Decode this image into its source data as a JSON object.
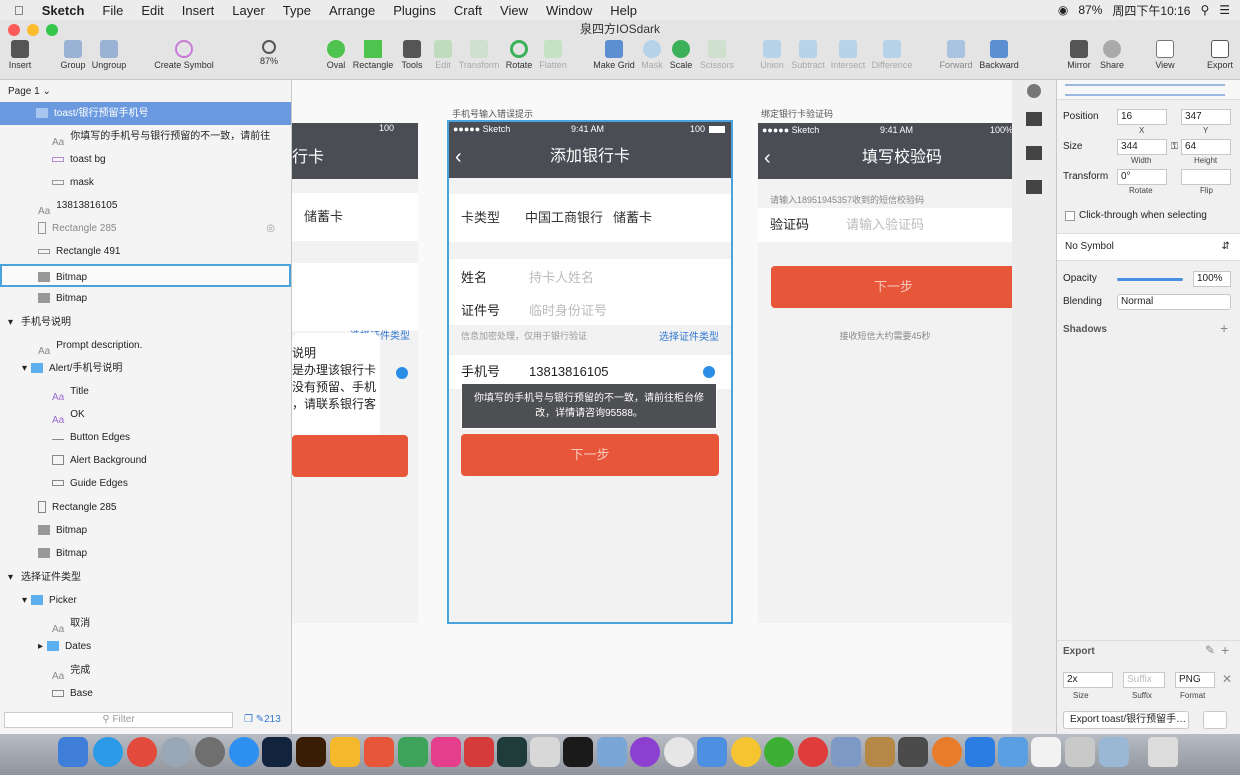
{
  "menubar": {
    "app": "Sketch",
    "items": [
      "File",
      "Edit",
      "Insert",
      "Layer",
      "Type",
      "Arrange",
      "Plugins",
      "Craft",
      "View",
      "Window",
      "Help"
    ],
    "battery": "87%",
    "clock": "周四下午10:16"
  },
  "window": {
    "title": "泉四方IOSdark"
  },
  "toolbar": {
    "insert": "Insert",
    "group": "Group",
    "ungroup": "Ungroup",
    "create_symbol": "Create Symbol",
    "zoom": "87%",
    "oval": "Oval",
    "rectangle": "Rectangle",
    "tools": "Tools",
    "edit": "Edit",
    "transform": "Transform",
    "rotate": "Rotate",
    "flatten": "Flatten",
    "make_grid": "Make Grid",
    "mask": "Mask",
    "scale": "Scale",
    "scissors": "Scissors",
    "union": "Union",
    "subtract": "Subtract",
    "intersect": "Intersect",
    "difference": "Difference",
    "forward": "Forward",
    "backward": "Backward",
    "mirror": "Mirror",
    "share": "Share",
    "view": "View",
    "export": "Export"
  },
  "layers": {
    "page": "Page 1 ⌄",
    "rows": [
      "toast/银行预留手机号",
      "你填写的手机号与银行预留的不一致，请前往",
      "toast bg",
      "mask",
      "13813816105",
      "Rectangle 285",
      "Rectangle 491",
      "Bitmap",
      "Bitmap",
      "手机号说明",
      "Prompt description.",
      "Alert/手机号说明",
      "Title",
      "OK",
      "Button Edges",
      "Alert Background",
      "Guide Edges",
      "Rectangle 285",
      "Bitmap",
      "Bitmap",
      "选择证件类型",
      "Picker",
      "取消",
      "Dates",
      "完成",
      "Base"
    ],
    "filter_placeholder": "Filter",
    "count": "213"
  },
  "artboards": {
    "left": {
      "nav_fragment": "行卡",
      "savings": "储蓄卡",
      "choose_id": "选择证件类型",
      "alert_lines": [
        "说明",
        "是办理该银行卡",
        "没有预留、手机",
        "，请联系银行客"
      ]
    },
    "center": {
      "label": "手机号输入错误提示",
      "carrier": "●●●●● Sketch",
      "time": "9:41 AM",
      "battery": "100",
      "title": "添加银行卡",
      "card_type_label": "卡类型",
      "bank": "中国工商银行",
      "card_kind": "储蓄卡",
      "name_label": "姓名",
      "name_placeholder": "持卡人姓名",
      "id_label": "证件号",
      "id_placeholder": "临时身份证号",
      "hint": "信息加密处理，仅用于银行验证",
      "choose_id": "选择证件类型",
      "phone_label": "手机号",
      "phone": "13813816105",
      "toast": "你填写的手机号与银行预留的不一致，请前往柜台修改，详情请咨询95588。",
      "next": "下一步"
    },
    "right": {
      "label": "绑定银行卡验证码",
      "carrier": "●●●●● Sketch",
      "time": "9:41 AM",
      "battery": "100%",
      "title": "填写校验码",
      "sms_hint": "请输入18951945357收到的短信校验码",
      "code_label": "验证码",
      "code_placeholder": "请输入验证码",
      "next": "下一步",
      "wait": "接收短信大约需要45秒"
    }
  },
  "inspector": {
    "position": "Position",
    "x": "16",
    "y": "347",
    "x_label": "X",
    "y_label": "Y",
    "size": "Size",
    "width": "344",
    "height": "64",
    "w_label": "Width",
    "h_label": "Height",
    "transform": "Transform",
    "rotate_val": "0°",
    "rotate_label": "Rotate",
    "flip_label": "Flip",
    "clickthrough": "Click-through when selecting",
    "symbol": "No Symbol",
    "opacity": "Opacity",
    "opacity_val": "100%",
    "blending": "Blending",
    "blending_val": "Normal",
    "shadows": "Shadows",
    "export": "Export",
    "scale": "2x",
    "suffix_placeholder": "Suffix",
    "format": "PNG",
    "size_label": "Size",
    "suffix_label": "Suffix",
    "format_label": "Format",
    "export_button": "Export toast/银行预留手…"
  },
  "colors": {
    "selection": "#6a99df",
    "navbar": "#4a4d54",
    "accent": "#e8563a",
    "artboard_outline": "#4aa3df"
  }
}
